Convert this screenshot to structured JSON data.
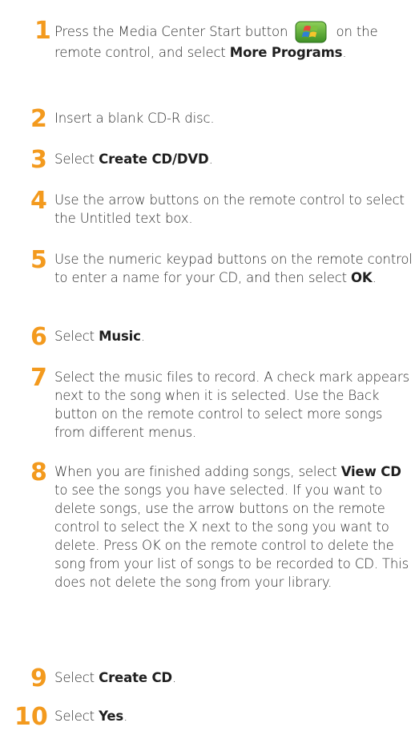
{
  "steps": [
    {
      "number": "1",
      "text_before": "Press the Media Center Start button ",
      "icon": "media-center-start-icon",
      "text_after": " on the remote control, and select ",
      "bold": "More Programs",
      "text_end": "."
    },
    {
      "number": "2",
      "text": "Insert a blank CD-R disc."
    },
    {
      "number": "3",
      "text_before": "Select ",
      "bold": "Create CD/DVD",
      "text_end": "."
    },
    {
      "number": "4",
      "text": "Use the arrow buttons on the remote control to select the Untitled text box."
    },
    {
      "number": "5",
      "text_before": "Use the numeric keypad buttons on the remote control to enter a name for your CD, and then select ",
      "bold": "OK",
      "text_end": "."
    },
    {
      "number": "6",
      "text_before": "Select ",
      "bold": "Music",
      "text_end": "."
    },
    {
      "number": "7",
      "text": "Select the music files to record. A check mark appears next to the song when it is selected. Use the Back button on the remote control to select more songs from different menus."
    },
    {
      "number": "8",
      "text_before": "When you are finished adding songs, select ",
      "bold": "View CD",
      "text_end": " to see the songs you have selected. If you want to delete songs, use the arrow buttons on the remote control to select the X next to the song you want to delete. Press OK on the remote control to delete the song from your list of songs to be recorded to CD. This does not delete the song from your library."
    },
    {
      "number": "9",
      "text_before": "Select ",
      "bold": "Create CD",
      "text_end": "."
    },
    {
      "number": "10",
      "text_before": "Select ",
      "bold": "Yes",
      "text_end": "."
    }
  ],
  "colors": {
    "step_number": "#f39a1e",
    "body_text": "#2b2b2b",
    "icon_green": "#5aa83a",
    "icon_blue": "#2f7fd6"
  }
}
